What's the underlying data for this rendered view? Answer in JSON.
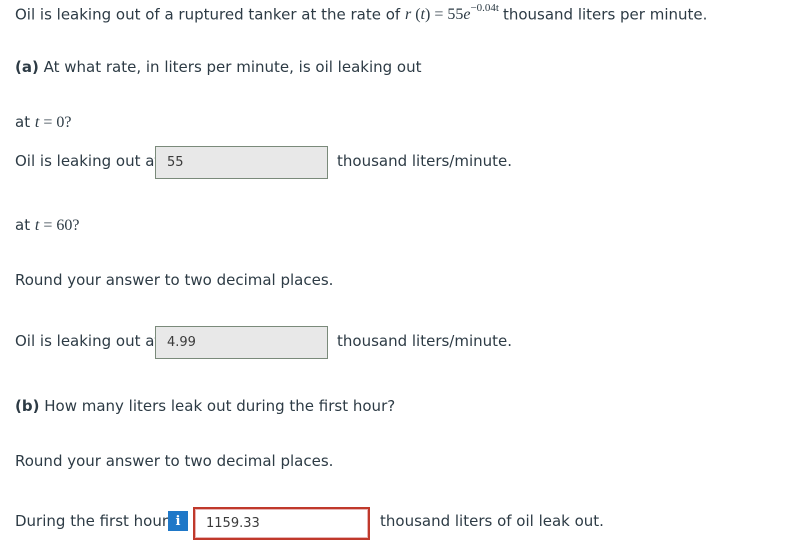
{
  "problem": {
    "intro_prefix": "Oil is leaking out of a ruptured tanker at the rate of",
    "rate_func": "r",
    "rate_var": "t",
    "rate_eq": "=",
    "rate_coef": "55",
    "rate_base": "e",
    "rate_exp": "−0.04t",
    "intro_suffix": "thousand liters per minute."
  },
  "part_a": {
    "label": "(a)",
    "question": "At what rate, in liters per minute, is oil leaking out",
    "q1_prefix": "at",
    "q1_var": "t",
    "q1_eq": "=",
    "q1_val": "0?",
    "answer1_prefix": "Oil is leaking out at",
    "answer1_value": "55",
    "answer1_suffix": "thousand liters/minute.",
    "q2_prefix": "at",
    "q2_var": "t",
    "q2_eq": "=",
    "q2_val": "60?",
    "round_note": "Round your answer to two decimal places.",
    "answer2_prefix": "Oil is leaking out at",
    "answer2_value": "4.99",
    "answer2_suffix": "thousand liters/minute."
  },
  "part_b": {
    "label": "(b)",
    "question": "How many liters leak out during the first hour?",
    "round_note": "Round your answer to two decimal places.",
    "answer_prefix": "During the first hour",
    "info_glyph": "i",
    "answer_value": "1159.33",
    "answer_suffix": "thousand liters of oil leak out."
  }
}
